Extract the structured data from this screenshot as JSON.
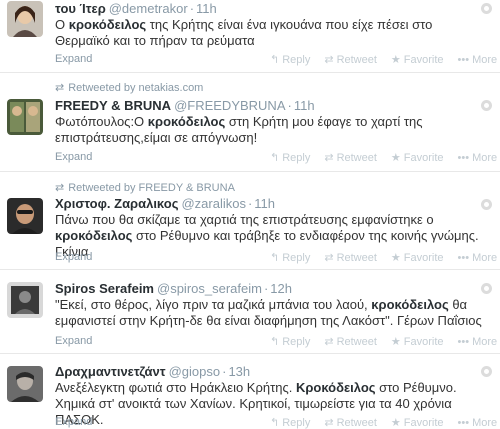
{
  "common": {
    "expand": "Expand",
    "reply": "Reply",
    "retweet": "Retweet",
    "favorite": "Favorite",
    "more": "More",
    "sep": "·"
  },
  "tweets": [
    {
      "fullname": "του Ίτερ",
      "username": "@demetrakor",
      "time": "11h",
      "retweeted_by": "",
      "before": "Ο ",
      "bold": "κροκόδειλος",
      "after": " της Κρήτης είναι ένα ιγκουάνα που είχε πέσει στο Θερμαϊκό και το πήραν τα ρεύματα"
    },
    {
      "fullname": "FREEDY & BRUNA",
      "username": "@FREEDYBRUNA",
      "time": "11h",
      "retweeted_by": "Retweeted by netakias.com",
      "before": "Φωτόπουλος:Ο ",
      "bold": "κροκόδειλος",
      "after": " στη Κρήτη μου έφαγε το χαρτί της επιστράτευσης,είμαι σε απόγνωση!"
    },
    {
      "fullname": "Χριστοφ. Ζαραλικος",
      "username": "@zaralikos",
      "time": "11h",
      "retweeted_by": "Retweeted by FREEDY & BRUNA",
      "before": "Πάνω που θα σκίζαμε τα χαρτιά της επιστράτευσης εμφανίστηκε ο ",
      "bold": "κροκόδειλος",
      "after": " στο Ρέθυμνο και τράβηξε το ενδιαφέρον της κοινής γνώμης. Γκίνια"
    },
    {
      "fullname": "Spiros Serafeim",
      "username": "@spiros_serafeim",
      "time": "12h",
      "retweeted_by": "",
      "before": "\"Εκεί, στο θέρος, λίγο πριν τα μαζικά μπάνια του λαού, ",
      "bold": "κροκόδειλος",
      "after": " θα εμφανιστεί στην Κρήτη-δε θα είναι διαφήμηση της Λακόστ\". Γέρων Παΐσιος"
    },
    {
      "fullname": "Δραχμαντινετζάντ",
      "username": "@giopso",
      "time": "13h",
      "retweeted_by": "",
      "before": "Ανεξέλεγκτη φωτιά στο Ηράκλειο Κρήτης. ",
      "bold": "Κροκόδειλος",
      "after": " στο Ρέθυμνο. Χημικά στ' ανοικτά των Χανίων. Κρητικοί, τιμωρείστε για τα 40 χρόνια ΠΑΣΟΚ."
    }
  ],
  "colors": {
    "meta": "#8899a6",
    "actions": "#c4cdd3",
    "text": "#333333"
  }
}
